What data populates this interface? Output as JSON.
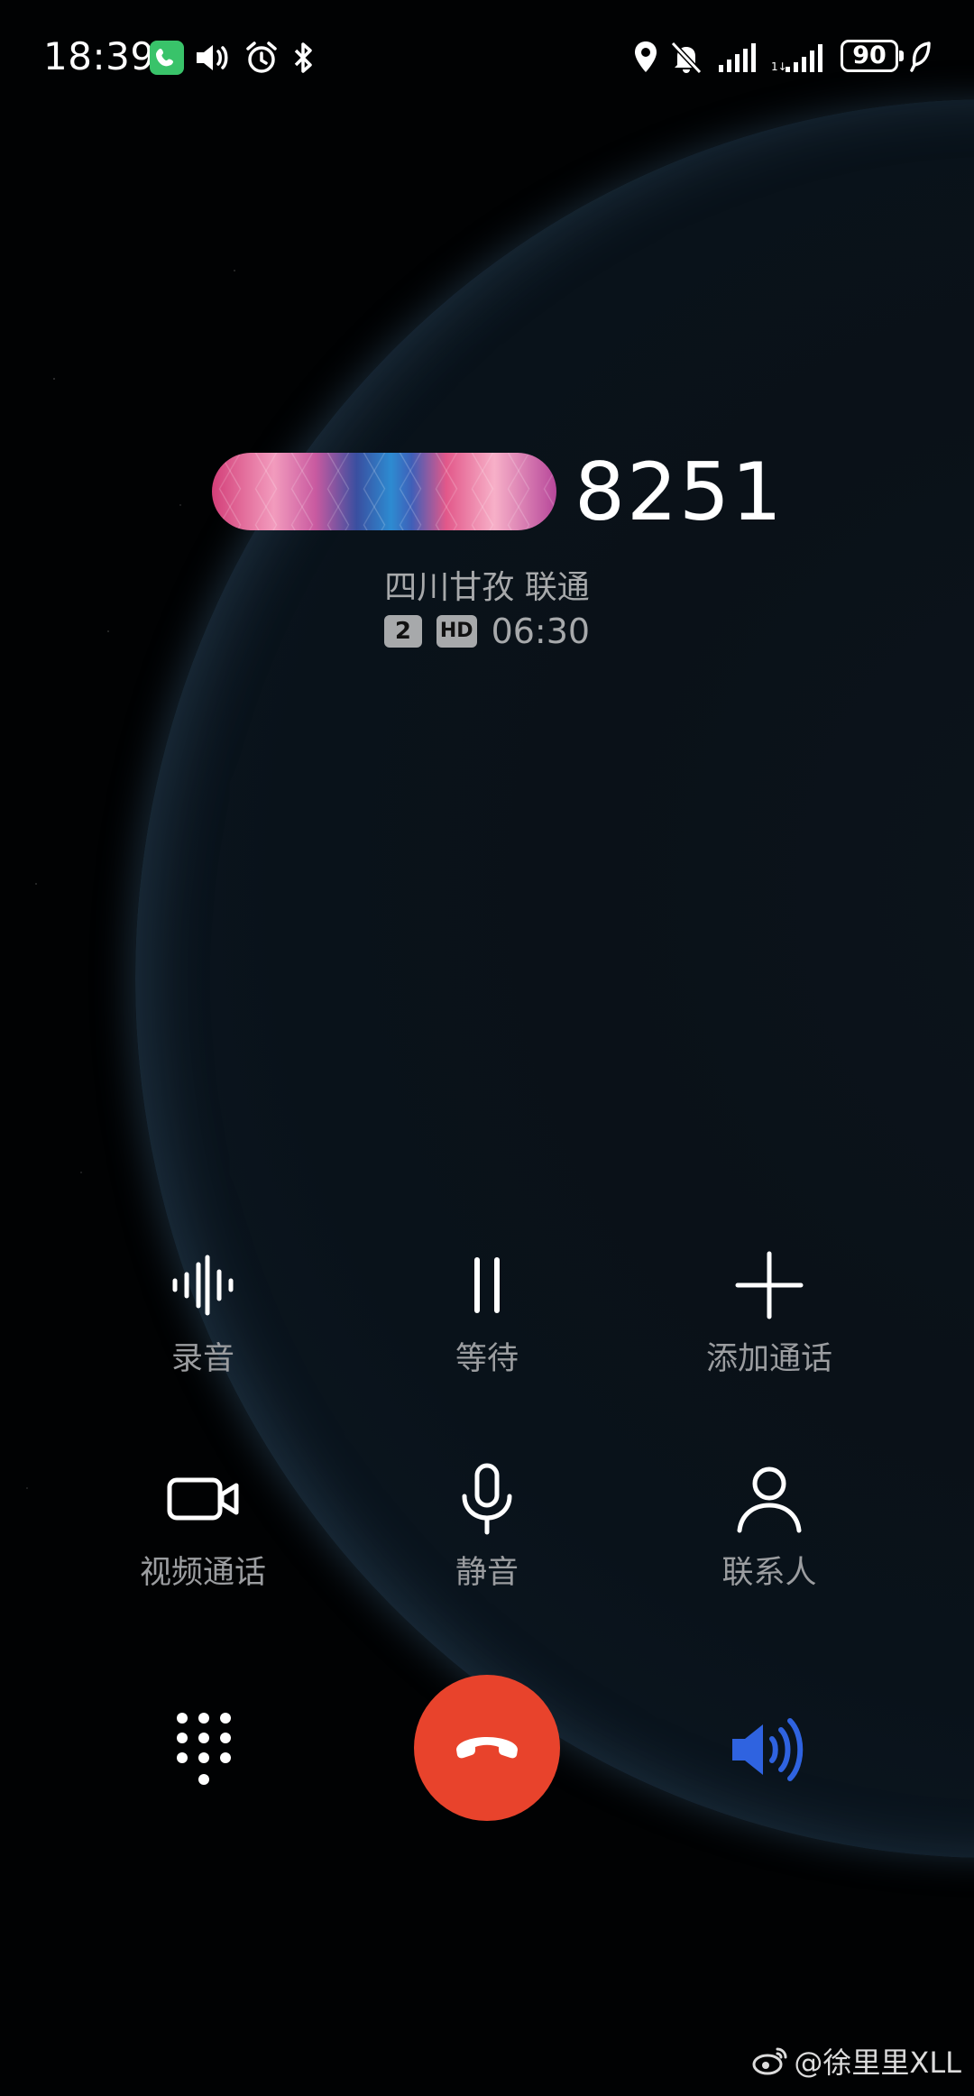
{
  "status_bar": {
    "time": "18:39",
    "battery": "90",
    "icons": [
      "phone-call-icon",
      "volume-icon",
      "alarm-icon",
      "bluetooth-icon",
      "location-icon",
      "bell-muted-icon",
      "signal-icon",
      "signal-sim2-icon",
      "battery-icon",
      "eco-leaf-icon"
    ]
  },
  "caller": {
    "number_suffix": "8251",
    "location": "四川甘孜 联通",
    "sim_badge": "2",
    "hd_badge": "HD",
    "duration": "06:30"
  },
  "controls": {
    "record": "录音",
    "hold": "等待",
    "add_call": "添加通话",
    "video_call": "视频通话",
    "mute": "静音",
    "contacts": "联系人"
  },
  "bottom": {
    "dialpad_icon": "dialpad-icon",
    "end_call_icon": "hang-up-icon",
    "speaker_icon": "speaker-icon",
    "speaker_active_color": "#2f63e0",
    "end_call_color": "#e8432c"
  },
  "watermark": {
    "text": "@徐里里XLL"
  }
}
